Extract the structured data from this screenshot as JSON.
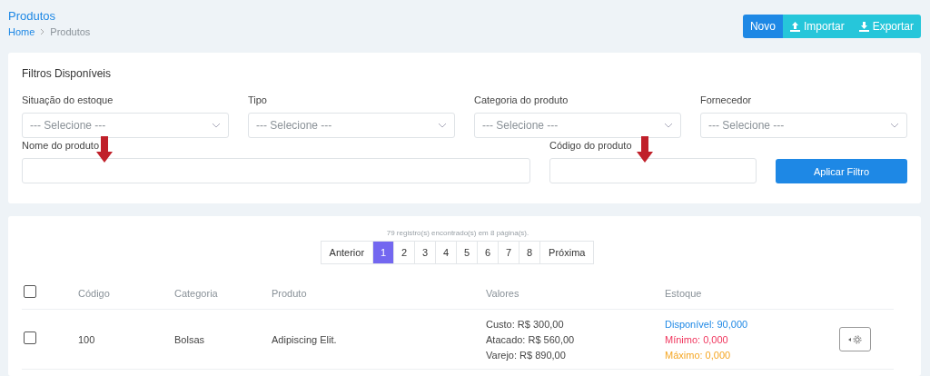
{
  "page_title": "Produtos",
  "breadcrumb": [
    {
      "label": "Home",
      "selected": false
    },
    {
      "label": "Produtos",
      "selected": true
    }
  ],
  "actions": [
    {
      "label": "Novo",
      "kind": "primary"
    },
    {
      "label": "Importar",
      "kind": "upload"
    },
    {
      "label": "Exportar",
      "kind": "download"
    }
  ],
  "filters": {
    "title": "Filtros Disponíveis",
    "selects": [
      {
        "label": "Situação do estoque",
        "placeholder": "--- Selecione ---"
      },
      {
        "label": "Tipo",
        "placeholder": "--- Selecione ---"
      },
      {
        "label": "Categoria do produto",
        "placeholder": "--- Selecione ---"
      },
      {
        "label": "Fornecedor",
        "placeholder": "--- Selecione ---"
      }
    ],
    "text_fields": [
      {
        "label": "Nome do produto"
      },
      {
        "label": "Código do produto"
      }
    ],
    "apply_button": "Aplicar Filtro"
  },
  "results": {
    "summary": "79 registro(s) encontrado(s) em 8 página(s).",
    "pagination": {
      "previous": "Anterior",
      "next": "Próxima",
      "pages": [
        {
          "label": "1",
          "selected": true
        },
        {
          "label": "2",
          "selected": false
        },
        {
          "label": "3",
          "selected": false
        },
        {
          "label": "4",
          "selected": false
        },
        {
          "label": "5",
          "selected": false
        },
        {
          "label": "6",
          "selected": false
        },
        {
          "label": "7",
          "selected": false
        },
        {
          "label": "8",
          "selected": false
        }
      ]
    },
    "select_all_checked": false,
    "columns": [
      "Código",
      "Categoria",
      "Produto",
      "Valores",
      "Estoque"
    ],
    "rows": [
      {
        "checked": false,
        "code": "100",
        "category": "Bolsas",
        "product": "Adipiscing Elit.",
        "values": [
          "Custo: R$ 300,00",
          "Atacado: R$ 560,00",
          "Varejo: R$ 890,00"
        ],
        "stock": [
          {
            "text": "Disponível: 90,000",
            "color": "#1e88e5"
          },
          {
            "text": "Mínimo: 0,000",
            "color": "#f0365e"
          },
          {
            "text": "Máximo: 0,000",
            "color": "#f5a623"
          }
        ]
      }
    ]
  }
}
